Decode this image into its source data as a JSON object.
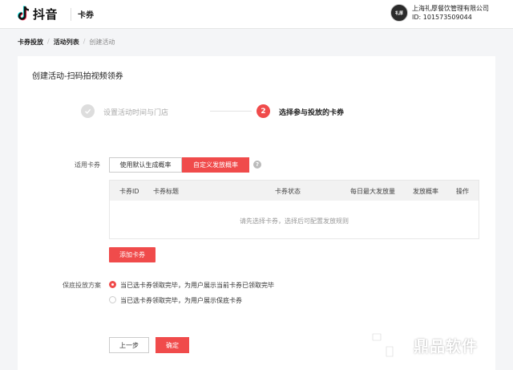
{
  "header": {
    "logo_text": "抖音",
    "product": "卡券",
    "company_name": "上海礼厚餐饮管理有限公司",
    "company_id": "ID: 101573509044",
    "avatar_text": "礼厚"
  },
  "breadcrumb": [
    "卡券投放",
    "活动列表",
    "创建活动"
  ],
  "breadcrumb_sep": "/",
  "page_title": "创建活动-扫码拍视频领券",
  "steps": {
    "step1": {
      "label": "设置活动时间与门店"
    },
    "step2": {
      "number": "2",
      "label": "选择参与投放的卡券"
    }
  },
  "coupon_field": {
    "label": "适用卡券",
    "option_default": "使用默认生成概率",
    "option_custom": "自定义发放概率",
    "help": "?"
  },
  "table": {
    "columns": [
      "卡券ID",
      "卡券标题",
      "卡券状态",
      "每日最大发放量",
      "发放概率",
      "操作"
    ],
    "empty_text": "请先选择卡券，选择后可配置发放规则"
  },
  "add_button": "添加卡券",
  "fallback": {
    "label": "保底投放方案",
    "option1": "当已选卡券领取完毕，为用户展示当前卡券已领取完毕",
    "option2": "当已选卡券领取完毕，为用户展示保底卡券"
  },
  "buttons": {
    "prev": "上一步",
    "confirm": "确定"
  },
  "watermark": {
    "text": "鼎品软件"
  },
  "colors": {
    "accent": "#f04b4b"
  }
}
